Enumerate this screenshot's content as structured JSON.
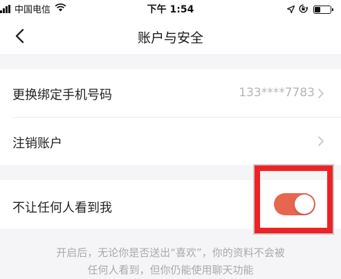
{
  "status_bar": {
    "carrier": "中国电信",
    "time": "下午 1:54",
    "icons": [
      "signal-icon",
      "wifi-icon",
      "location-icon",
      "rotation-lock-icon",
      "battery-icon"
    ]
  },
  "nav": {
    "title": "账户与安全",
    "back_icon": "chevron-left-icon"
  },
  "rows": [
    {
      "label": "更换绑定手机号码",
      "value": "133****7783",
      "icon": "chevron-right-icon"
    },
    {
      "label": "注销账户",
      "value": "",
      "icon": "chevron-right-icon"
    }
  ],
  "privacy": {
    "label": "不让任何人看到我",
    "toggle_on": true,
    "toggle_color": "#e8664f",
    "highlight_color": "#ee2224",
    "note_line1": "开启后，无论你是否送出“喜欢”，你的资料不会被",
    "note_line2": "任何人看到，但你仍能使用聊天功能"
  }
}
